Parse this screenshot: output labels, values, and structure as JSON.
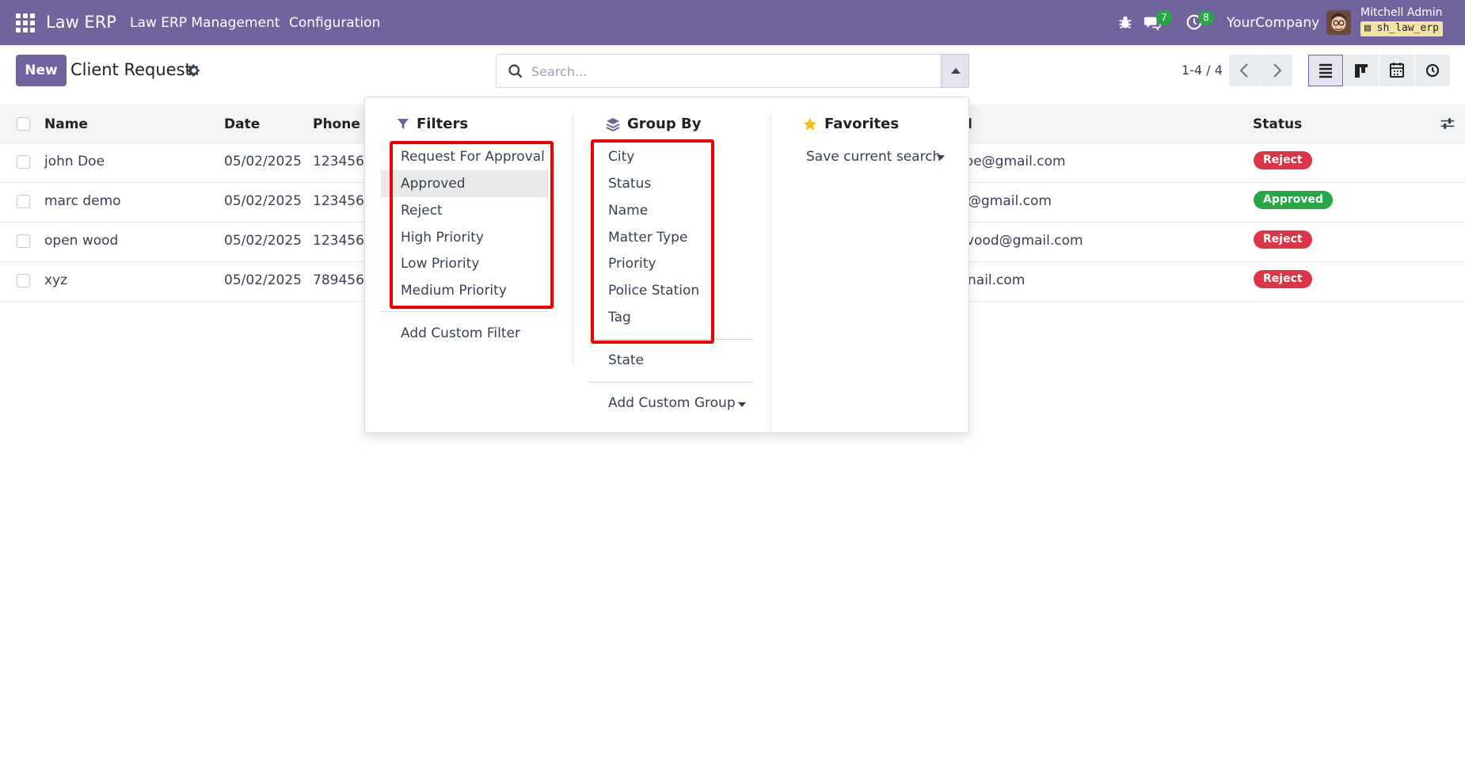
{
  "navbar": {
    "brand": "Law ERP",
    "menu": [
      "Law ERP Management",
      "Configuration"
    ],
    "messages_count": "7",
    "activities_count": "8",
    "company": "YourCompany",
    "user_name": "Mitchell Admin",
    "db_name": "sh_law_erp"
  },
  "control": {
    "new_label": "New",
    "title": "Client Request",
    "search_placeholder": "Search...",
    "pager": "1-4 / 4"
  },
  "table": {
    "headers": [
      "Name",
      "Date",
      "Phone N",
      "l",
      "Status"
    ],
    "rows": [
      {
        "name": "john Doe",
        "date": "05/02/2025",
        "phone": "1234567",
        "email": "doe@gmail.com",
        "status": "Reject"
      },
      {
        "name": "marc demo",
        "date": "05/02/2025",
        "phone": "1234567",
        "email": "@gmail.com",
        "status": "Approved"
      },
      {
        "name": "open wood",
        "date": "05/02/2025",
        "phone": "1234567",
        "email": "vood@gmail.com",
        "status": "Reject"
      },
      {
        "name": "xyz",
        "date": "05/02/2025",
        "phone": "7894561",
        "email": "nail.com",
        "status": "Reject"
      }
    ]
  },
  "dropdown": {
    "filters": {
      "title": "Filters",
      "items": [
        "Request For Approval",
        "Approved",
        "Reject",
        "High Priority",
        "Low Priority",
        "Medium Priority"
      ],
      "add_custom": "Add Custom Filter"
    },
    "group_by": {
      "title": "Group By",
      "items": [
        "City",
        "Status",
        "Name",
        "Matter Type",
        "Priority",
        "Police Station",
        "Tag"
      ],
      "extra": "State",
      "add_custom": "Add Custom Group"
    },
    "favorites": {
      "title": "Favorites",
      "save": "Save current search"
    }
  },
  "colors": {
    "brand": "#71639e",
    "reject": "#dc3545",
    "approved": "#28a745",
    "highlight": "#ee0000"
  }
}
